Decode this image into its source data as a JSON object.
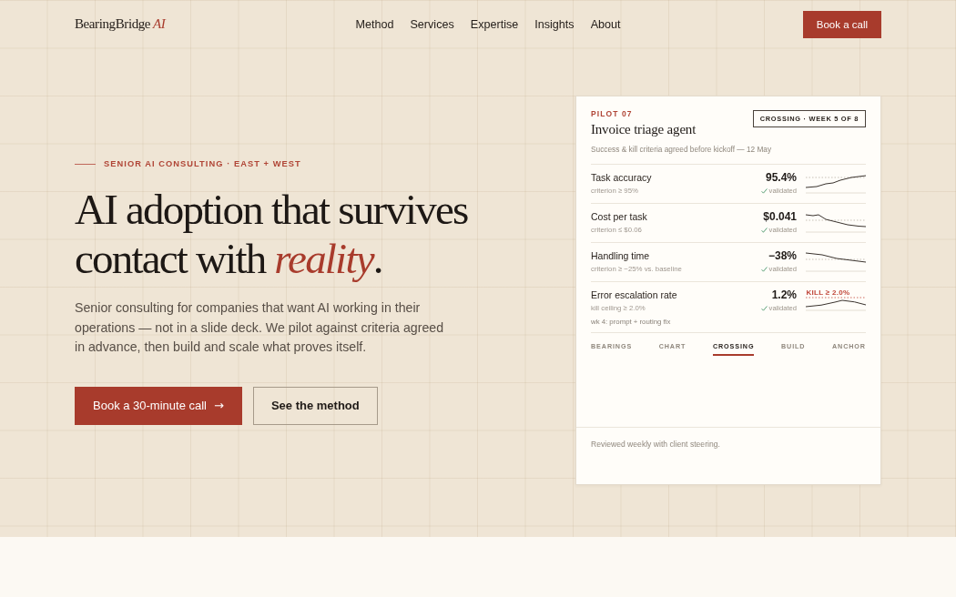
{
  "header": {
    "logo": {
      "name": "BearingBridge",
      "mark": "AI"
    },
    "nav": [
      "Method",
      "Services",
      "Expertise",
      "Insights",
      "About"
    ],
    "cta": "Book a call"
  },
  "hero": {
    "eyebrow": "SENIOR AI CONSULTING · EAST + WEST",
    "headline_lines": [
      "AI adoption that survives",
      "contact with *reality*."
    ],
    "body": "Senior consulting for companies that want AI working in their operations — not in a slide deck. We pilot against criteria agreed in advance, then build and scale what proves itself.",
    "buttons": [
      {
        "label": "Book a 30-minute call",
        "icon": "→",
        "kind": "primary"
      },
      {
        "label": "See the method",
        "kind": "secondary"
      }
    ]
  },
  "pilot_card": {
    "tag": "PILOT 07",
    "title": "Invoice triage agent",
    "status": "CROSSING · WEEK 5 OF 8",
    "subtitle": "Success & kill criteria agreed before kickoff — 12 May",
    "metrics": [
      {
        "name": "Task accuracy",
        "criterion": "criterion ≥ 95%",
        "value": "95.4%",
        "verdict": "validated",
        "kind": "criterion"
      },
      {
        "name": "Cost per task",
        "criterion": "criterion ≤ $0.06",
        "value": "$0.041",
        "verdict": "validated",
        "kind": "criterion"
      },
      {
        "name": "Handling time",
        "criterion": "criterion ≥ −25% vs. baseline",
        "value": "−38%",
        "verdict": "validated",
        "kind": "criterion"
      },
      {
        "name": "Error escalation rate",
        "criterion": "kill ceiling ≥ 2.0%",
        "value": "1.2%",
        "verdict": "validated",
        "kind": "kill",
        "threshold_label": "KILL ≥ 2.0%",
        "note": "wk 4: prompt + routing fix"
      }
    ],
    "tabs": [
      {
        "label": "BEARINGS",
        "selected": false
      },
      {
        "label": "CHART",
        "selected": false
      },
      {
        "label": "CROSSING",
        "selected": true
      },
      {
        "label": "BUILD",
        "selected": false
      },
      {
        "label": "ANCHOR",
        "selected": false
      }
    ],
    "footer": "Reviewed weekly with client steering."
  }
}
